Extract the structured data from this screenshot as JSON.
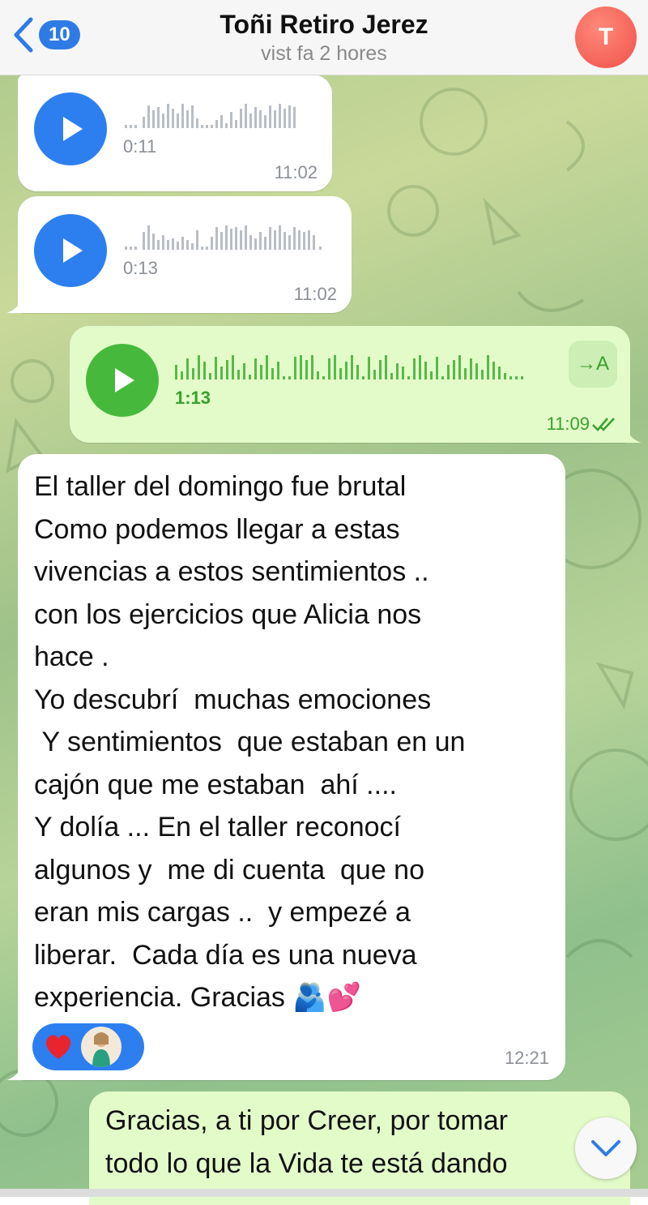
{
  "header": {
    "back_count": "10",
    "title": "Toñi Retiro Jerez",
    "subtitle": "vist fa 2 hores",
    "avatar_initial": "T"
  },
  "messages": [
    {
      "type": "voice",
      "direction": "in",
      "duration": "0:11",
      "time": "11:02"
    },
    {
      "type": "voice",
      "direction": "in",
      "duration": "0:13",
      "time": "11:02"
    },
    {
      "type": "voice",
      "direction": "out",
      "duration": "1:13",
      "time": "11:09",
      "transcribe_label": "→A",
      "read_status": "double-check"
    },
    {
      "type": "text",
      "direction": "in",
      "time": "12:21",
      "text": "El taller del domingo fue brutal\nComo podemos llegar a estas\nvivencias a estos sentimientos ..\ncon los ejercicios que Alicia nos\nhace .\nYo descubrí  muchas emociones\n Y sentimientos  que estaban en un\ncajón que me estaban  ahí ....\nY dolía ... En el taller reconocí\nalgunos y  me di cuenta  que no\neran mis cargas ..  y empezé a\nliberar.  Cada día es una nueva\nexperiencia. Gracias 🫂💕",
      "reactions": [
        "red-heart",
        "user-avatar"
      ]
    },
    {
      "type": "text",
      "direction": "out",
      "text": "Gracias, a ti por Creer, por tomar\ntodo lo que la Vida te está dando"
    }
  ],
  "colors": {
    "accent_blue": "#2d7ff0",
    "accent_green": "#46b93d",
    "outgoing_bubble": "#e3fbc9",
    "incoming_bubble": "#ffffff",
    "avatar": "#f0504a"
  },
  "icons": {
    "back": "chevron-left-icon",
    "play": "play-icon",
    "scroll": "chevron-down-icon"
  }
}
